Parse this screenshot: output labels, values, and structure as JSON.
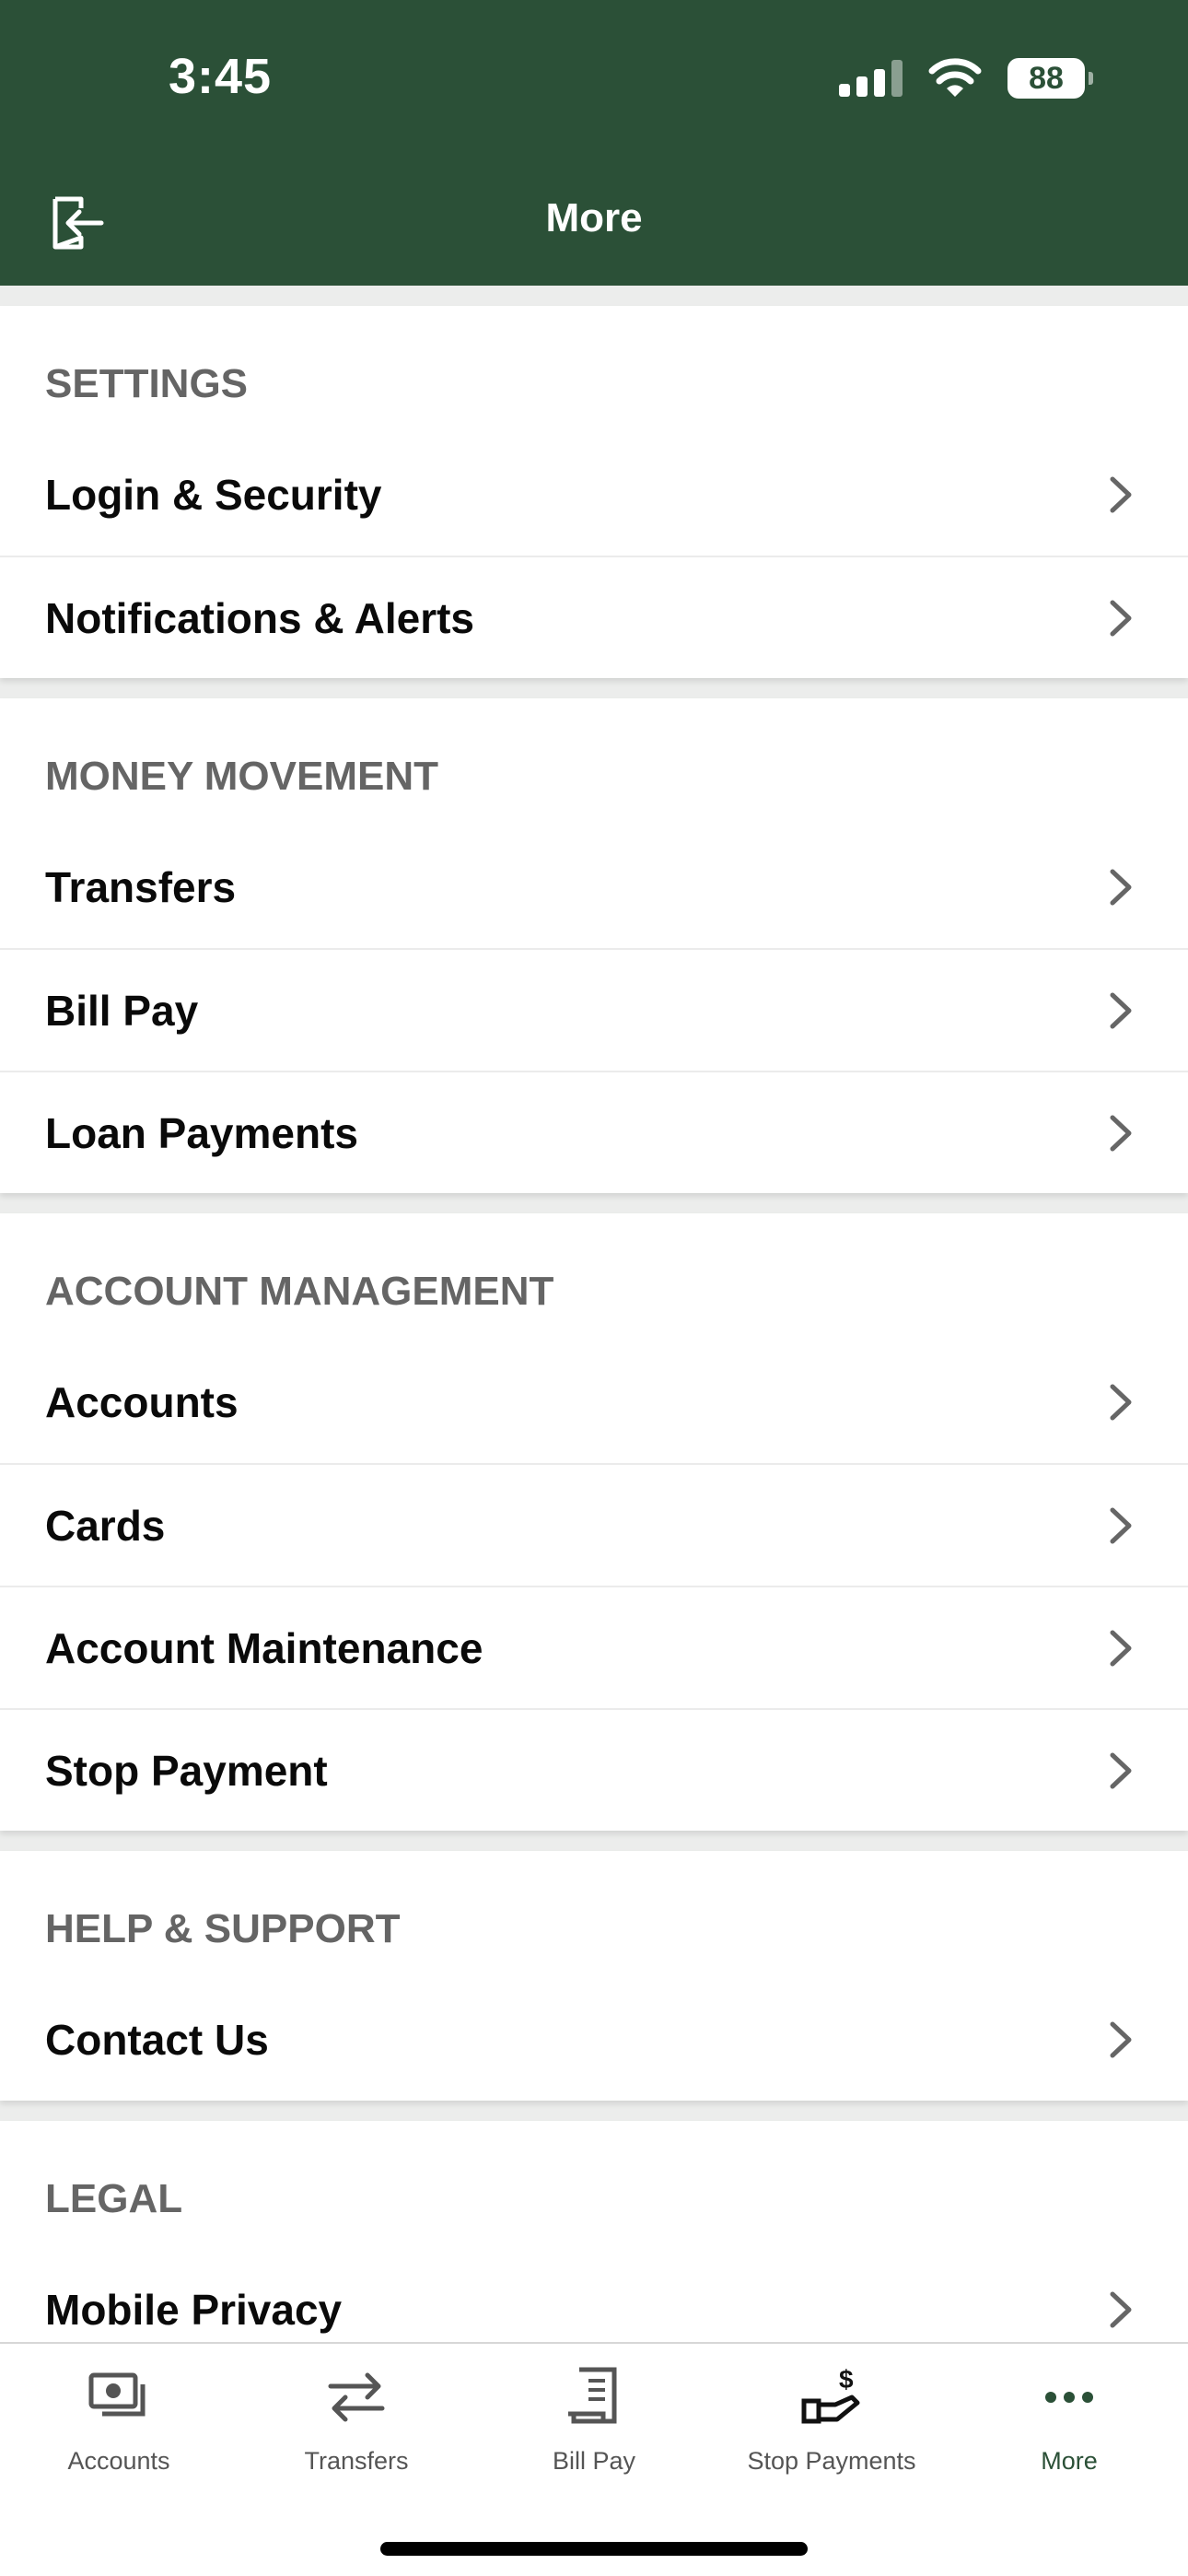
{
  "status": {
    "time": "3:45",
    "battery": "88"
  },
  "header": {
    "title": "More"
  },
  "sections": [
    {
      "title": "SETTINGS",
      "items": [
        "Login & Security",
        "Notifications & Alerts"
      ]
    },
    {
      "title": "MONEY MOVEMENT",
      "items": [
        "Transfers",
        "Bill Pay",
        "Loan Payments"
      ]
    },
    {
      "title": "ACCOUNT MANAGEMENT",
      "items": [
        "Accounts",
        "Cards",
        "Account Maintenance",
        "Stop Payment"
      ]
    },
    {
      "title": "HELP & SUPPORT",
      "items": [
        "Contact Us"
      ]
    },
    {
      "title": "LEGAL",
      "items": [
        "Mobile Privacy"
      ]
    }
  ],
  "tabs": [
    {
      "label": "Accounts",
      "icon": "accounts-icon"
    },
    {
      "label": "Transfers",
      "icon": "transfers-icon"
    },
    {
      "label": "Bill Pay",
      "icon": "bill-pay-icon"
    },
    {
      "label": "Stop Payments",
      "icon": "stop-payments-icon"
    },
    {
      "label": "More",
      "icon": "more-icon",
      "active": true
    }
  ],
  "colors": {
    "brand": "#2b5037",
    "section_title": "#656565",
    "background": "#ecedec"
  }
}
